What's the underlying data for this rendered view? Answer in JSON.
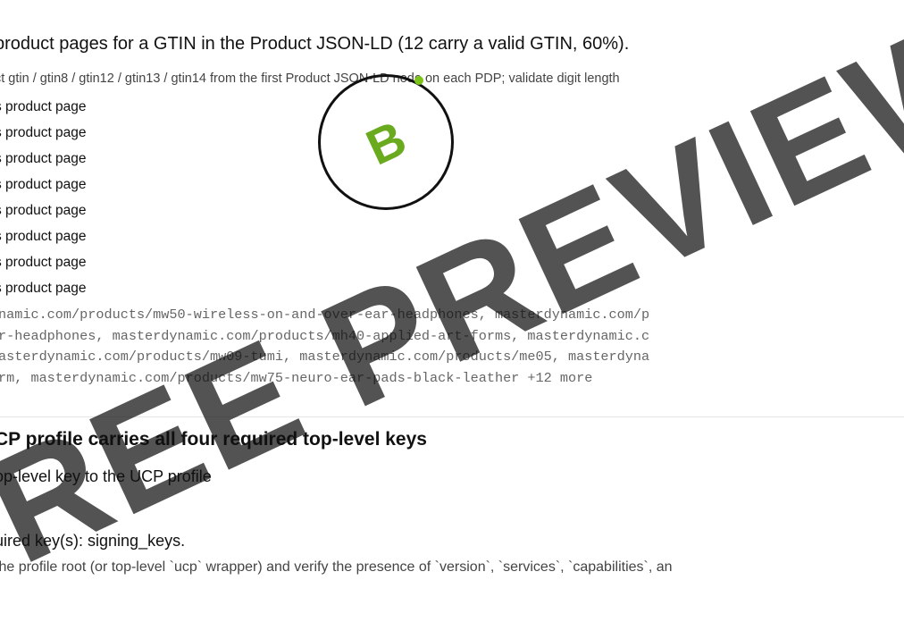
{
  "section_gtin": {
    "title": "product pages for a GTIN in the Product JSON-LD (12 carry a valid GTIN, 60%).",
    "description": "ct gtin / gtin8 / gtin12 / gtin13 / gtin14 from the first Product JSON-LD node on each PDP; validate digit length",
    "items": [
      "s product page",
      "s product page",
      "s product page",
      "s product page",
      "s product page",
      "s product page",
      "s product page",
      "s product page"
    ],
    "urls": [
      "namic.com/products/mw50-wireless-on-and-over-ear-headphones, masterdynamic.com/p",
      "r-headphones, masterdynamic.com/products/mh40-applied-art-forms, masterdynamic.c",
      "asterdynamic.com/products/mw09-tumi, masterdynamic.com/products/me05, masterdyna",
      "rm, masterdynamic.com/products/mw75-neuro-ear-pads-black-leather +12 more"
    ]
  },
  "section_ucp": {
    "title": "CP profile carries all four required top-level keys",
    "fix": "op-level key to the UCP profile",
    "detail": "uired key(s): signing_keys.",
    "note": "the profile root (or top-level `ucp` wrapper) and verify the presence of `version`, `services`, `capabilities`, an"
  },
  "badge": {
    "grade": "B"
  },
  "watermark": {
    "text": "FREE PREVIEW"
  }
}
